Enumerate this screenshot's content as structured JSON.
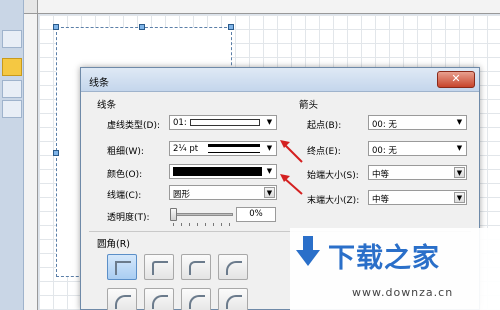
{
  "dialog": {
    "title": "线条",
    "close_label": "✕",
    "line_section": {
      "heading": "线条",
      "dash_type": {
        "label": "虚线类型(D):",
        "value": "01:"
      },
      "weight": {
        "label": "粗细(W):",
        "value": "2¼ pt"
      },
      "color": {
        "label": "颜色(O):",
        "value": "#000000"
      },
      "cap": {
        "label": "线端(C):",
        "value": "圆形"
      },
      "transparency": {
        "label": "透明度(T):",
        "value": "0%",
        "level_percent": 0
      }
    },
    "arrow_section": {
      "heading": "箭头",
      "begin": {
        "label": "起点(B):",
        "value": "00: 无"
      },
      "end": {
        "label": "终点(E):",
        "value": "00: 无"
      },
      "begin_size": {
        "label": "始端大小(S):",
        "value": "中等"
      },
      "end_size": {
        "label": "末端大小(Z):",
        "value": "中等"
      }
    },
    "corner_section": {
      "heading": "圆角(R)"
    }
  },
  "watermark": {
    "text": "下载之家",
    "url": "www.downza.cn"
  },
  "colors": {
    "annotation_arrow": "#d42020",
    "selected_corner": "#a9cdf2",
    "watermark_blue": "#2a6fc9"
  }
}
